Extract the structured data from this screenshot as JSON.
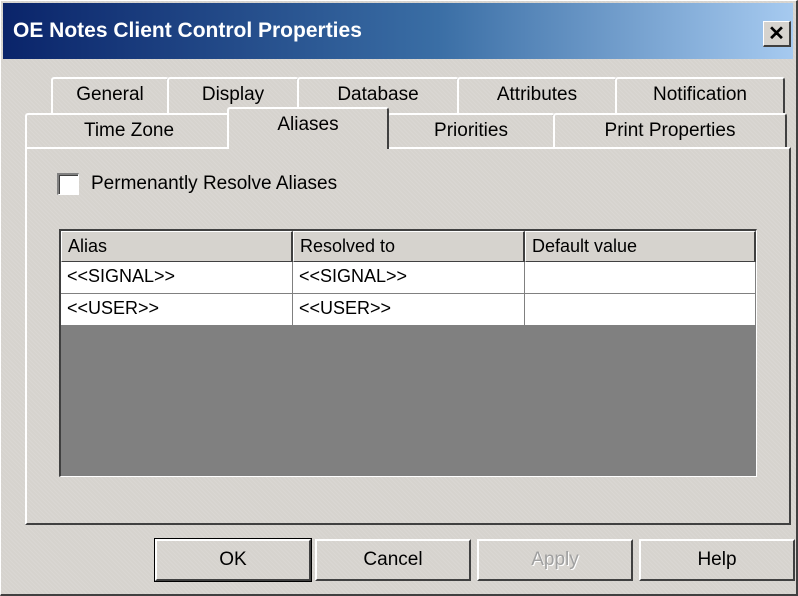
{
  "window": {
    "title": "OE Notes Client Control Properties",
    "close_glyph": "✕"
  },
  "tabs": {
    "row_back": [
      "General",
      "Display",
      "Database",
      "Attributes",
      "Notification"
    ],
    "row_front": [
      "Time Zone",
      "Aliases",
      "Priorities",
      "Print Properties"
    ],
    "active": "Aliases"
  },
  "aliases_page": {
    "checkbox_label": "Permenantly Resolve Aliases",
    "checkbox_checked": false,
    "table": {
      "columns": [
        "Alias",
        "Resolved to",
        "Default value"
      ],
      "rows": [
        [
          "<<SIGNAL>>",
          "<<SIGNAL>>",
          ""
        ],
        [
          "<<USER>>",
          "<<USER>>",
          ""
        ]
      ]
    }
  },
  "buttons": {
    "ok": "OK",
    "cancel": "Cancel",
    "apply": "Apply",
    "help": "Help"
  },
  "colors": {
    "title_gradient_start": "#0a246a",
    "title_gradient_end": "#a6caf0",
    "face": "#d6d3ce",
    "grid_background": "#808080"
  }
}
